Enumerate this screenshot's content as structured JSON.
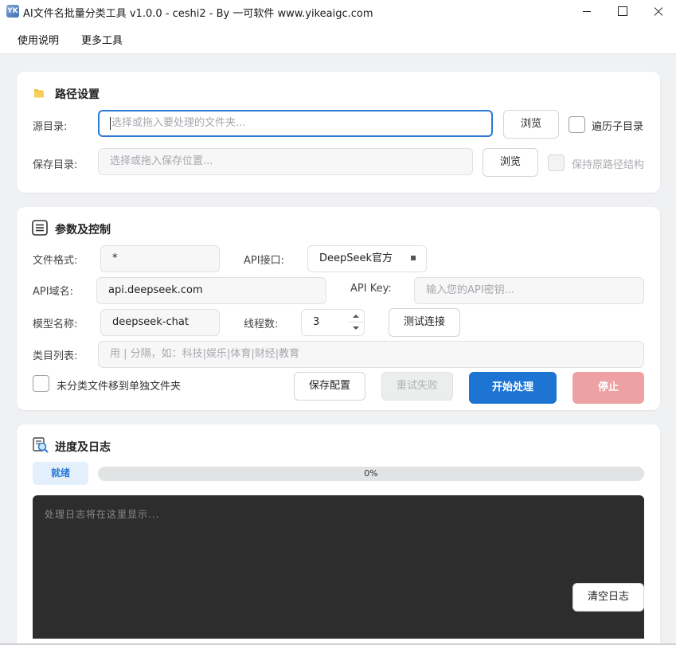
{
  "window": {
    "icon_text": "YK",
    "title": "AI文件名批量分类工具 v1.0.0 - ceshi2 - By 一可软件 www.yikeaigc.com"
  },
  "menu": {
    "items": [
      "使用说明",
      "更多工具"
    ]
  },
  "path_section": {
    "title": "路径设置",
    "source_label": "源目录:",
    "source_placeholder": "选择或拖入要处理的文件夹...",
    "browse_label": "浏览",
    "recurse_label": "遍历子目录",
    "save_label": "保存目录:",
    "save_placeholder": "选择或拖入保存位置...",
    "browse2_label": "浏览",
    "keep_structure_label": "保持原路径结构"
  },
  "params_section": {
    "title": "参数及控制",
    "file_format_label": "文件格式:",
    "file_format_value": "*",
    "api_label": "API接口:",
    "api_value": "DeepSeek官方",
    "domain_label": "API域名:",
    "domain_value": "api.deepseek.com",
    "key_label": "API Key:",
    "key_placeholder": "输入您的API密钥...",
    "model_label": "模型名称:",
    "model_value": "deepseek-chat",
    "threads_label": "线程数:",
    "threads_value": "3",
    "test_button": "测试连接",
    "categories_label": "类目列表:",
    "categories_placeholder": "用 | 分隔，如：科技|娱乐|体育|财经|教育",
    "move_unclassified_label": "未分类文件移到单独文件夹",
    "save_config_button": "保存配置",
    "retry_button": "重试失败",
    "start_button": "开始处理",
    "stop_button": "停止"
  },
  "progress_section": {
    "title": "进度及日志",
    "status": "就绪",
    "progress_percent": 0,
    "progress_text": "0%",
    "log_placeholder": "处理日志将在这里显示...",
    "clear_log_button": "清空日志"
  },
  "colors": {
    "primary": "#1e74d2",
    "stop": "#eea1a2",
    "focus_border": "#2b7ad4",
    "log_bg": "#2d2d2d"
  }
}
